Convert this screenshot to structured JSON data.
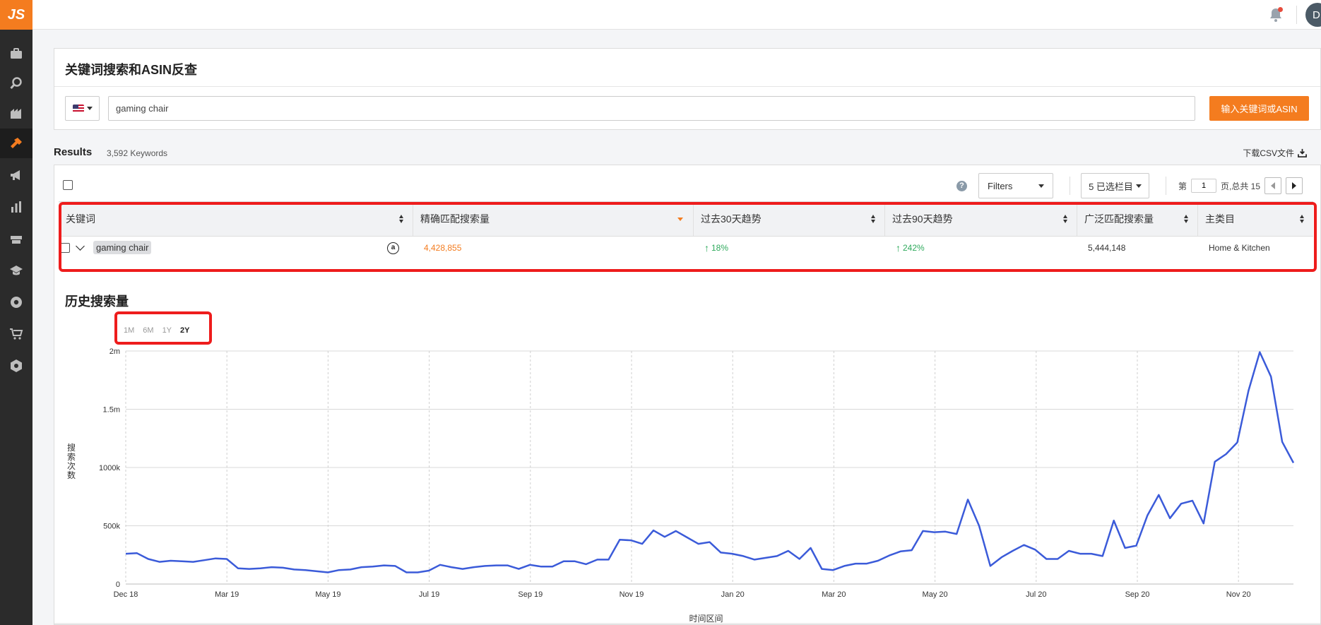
{
  "app": {
    "logo": "JS",
    "avatar_initial": "D"
  },
  "sidebar": {
    "items": [
      {
        "icon": "briefcase-icon",
        "active": false
      },
      {
        "icon": "search-icon",
        "active": false
      },
      {
        "icon": "warehouse-icon",
        "active": false
      },
      {
        "icon": "keyword-tool-icon",
        "active": true
      },
      {
        "icon": "megaphone-icon",
        "active": false
      },
      {
        "icon": "bar-chart-icon",
        "active": false
      },
      {
        "icon": "graduation-cap-icon",
        "active": false
      },
      {
        "icon": "academy-icon",
        "active": false
      },
      {
        "icon": "chrome-icon",
        "active": false
      },
      {
        "icon": "cart-icon",
        "active": false
      },
      {
        "icon": "settings-hex-icon",
        "active": false
      }
    ]
  },
  "search": {
    "title": "关键词搜索和ASIN反查",
    "query": "gaming chair",
    "button_label": "输入关键词或ASIN"
  },
  "results": {
    "title": "Results",
    "count": "3,592 Keywords",
    "download_label": "下载CSV文件",
    "filters_label": "Filters",
    "columns_label": "5 已选栏目",
    "pager": {
      "prefix": "第",
      "page": "1",
      "suffix": "页,总共 15"
    },
    "help_glyph": "?",
    "columns": [
      "关键词",
      "精确匹配搜索量",
      "过去30天趋势",
      "过去90天趋势",
      "广泛匹配搜索量",
      "主类目"
    ],
    "row": {
      "keyword": "gaming chair",
      "exact_volume": "4,428,855",
      "trend_30": "18%",
      "trend_90": "242%",
      "broad_volume": "5,444,148",
      "category": "Home & Kitchen"
    }
  },
  "history": {
    "title": "历史搜索量",
    "ranges": [
      "1M",
      "6M",
      "1Y",
      "2Y"
    ],
    "active_range": "2Y"
  },
  "chart_data": {
    "type": "line",
    "xlabel": "时间区间",
    "ylabel": "搜索次数",
    "x_ticks": [
      "Dec 18",
      "Mar 19",
      "May 19",
      "Jul 19",
      "Sep 19",
      "Nov 19",
      "Jan 20",
      "Mar 20",
      "May 20",
      "Jul 20",
      "Sep 20",
      "Nov 20"
    ],
    "y_ticks": [
      "0",
      "500k",
      "1000k",
      "1.5m",
      "2m"
    ],
    "ylim": [
      0,
      2000000
    ],
    "grid": true,
    "color": "#3b5bd9",
    "series": [
      {
        "values": [
          260000,
          265000,
          215000,
          190000,
          200000,
          195000,
          190000,
          205000,
          220000,
          215000,
          135000,
          130000,
          135000,
          145000,
          140000,
          125000,
          120000,
          110000,
          100000,
          120000,
          125000,
          145000,
          150000,
          160000,
          155000,
          100000,
          100000,
          115000,
          165000,
          145000,
          130000,
          145000,
          155000,
          160000,
          160000,
          130000,
          165000,
          150000,
          150000,
          195000,
          195000,
          170000,
          210000,
          210000,
          380000,
          375000,
          345000,
          460000,
          405000,
          455000,
          400000,
          345000,
          360000,
          270000,
          260000,
          240000,
          210000,
          225000,
          240000,
          285000,
          215000,
          310000,
          130000,
          120000,
          155000,
          175000,
          175000,
          200000,
          245000,
          280000,
          290000,
          455000,
          445000,
          450000,
          430000,
          725000,
          500000,
          155000,
          230000,
          285000,
          335000,
          295000,
          215000,
          215000,
          285000,
          260000,
          260000,
          240000,
          545000,
          310000,
          330000,
          590000,
          765000,
          565000,
          690000,
          715000,
          520000,
          1050000,
          1115000,
          1215000,
          1660000,
          1990000,
          1780000,
          1220000,
          1040000
        ]
      }
    ]
  }
}
